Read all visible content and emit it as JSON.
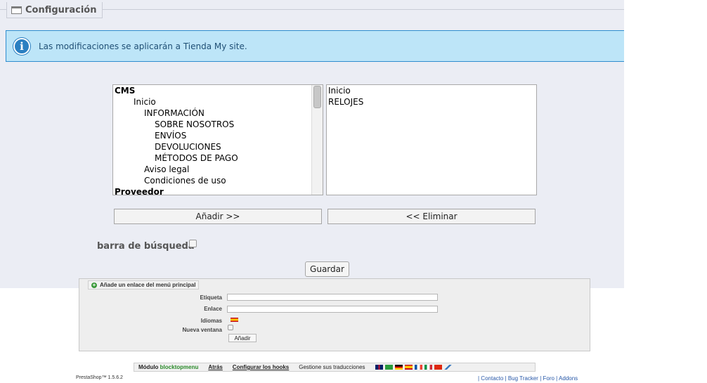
{
  "config": {
    "title": "Configuración",
    "info_message": "Las modificaciones se aplicarán a Tienda My site.",
    "available_items": [
      {
        "label": "CMS",
        "level": 0,
        "bold": true
      },
      {
        "label": "Inicio",
        "level": 1,
        "bold": false
      },
      {
        "label": "INFORMACIÓN",
        "level": 2,
        "bold": false
      },
      {
        "label": "SOBRE NOSOTROS",
        "level": 3,
        "bold": false
      },
      {
        "label": "ENVÍOS",
        "level": 3,
        "bold": false
      },
      {
        "label": "DEVOLUCIONES",
        "level": 3,
        "bold": false
      },
      {
        "label": "MÉTODOS DE PAGO",
        "level": 3,
        "bold": false
      },
      {
        "label": "Aviso legal",
        "level": 2,
        "bold": false
      },
      {
        "label": "Condiciones de uso",
        "level": 2,
        "bold": false
      },
      {
        "label": "Proveedor",
        "level": 0,
        "bold": true
      }
    ],
    "selected_items": [
      "Inicio",
      "RELOJES"
    ],
    "add_button": "Añadir >>",
    "remove_button": "<< Eliminar",
    "search_bar_label": "barra de búsqueda",
    "search_bar_checked": false,
    "save_button": "Guardar"
  },
  "add_link": {
    "title": "Añade un enlace del menú principal",
    "label_field": "Etiqueta",
    "link_field": "Enlace",
    "languages_label": "Idiomas",
    "new_window_label": "Nueva ventana",
    "add_button": "Añadir"
  },
  "module_bar": {
    "module_prefix": "Módulo",
    "module_name": "blocktopmenu",
    "back": "Atrás",
    "configure_hooks": "Configurar los hooks",
    "manage_translations": "Gestione sus traducciones"
  },
  "footer": {
    "version": "PrestaShop™ 1.5.6.2",
    "links": "| Contacto | Bug Tracker | Foro | Addons"
  },
  "colors": {
    "info_bg": "#bde5f8",
    "info_border": "#2f8dcf",
    "panel_bg": "#ebedf4",
    "module_name": "#2a8a2a"
  }
}
